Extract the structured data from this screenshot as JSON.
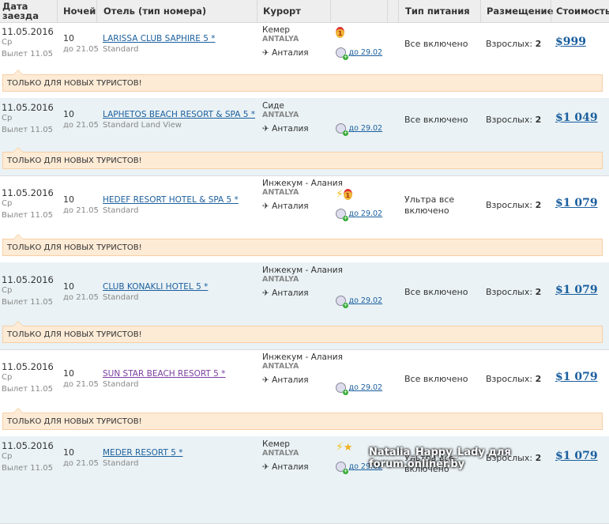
{
  "headers": [
    "Дата заезда",
    "Ночей",
    "Отель (тип номера)",
    "Курорт",
    "",
    "",
    "Тип питания",
    "Размещение",
    "Стоимость"
  ],
  "notice": "ТОЛЬКО ДЛЯ НОВЫХ ТУРИСТОВ!",
  "rows": [
    {
      "date": "11.05.2016",
      "dow": "Ср",
      "departure": "Вылет 11.05",
      "nights": "10",
      "until": "до 21.05",
      "hotel": "LARISSA CLUB SAPHIRE 5 *",
      "room": "Standard",
      "resort": "Кемер",
      "region": "ANTALYA",
      "airport": "Анталия",
      "deadline": "до 29.02",
      "meal": "Все включено",
      "acc_label": "Взрослых:",
      "acc_value": "2",
      "price": "$999",
      "icons": [
        "medal-icon"
      ]
    },
    {
      "date": "11.05.2016",
      "dow": "Ср",
      "departure": "Вылет 11.05",
      "nights": "10",
      "until": "до 21.05",
      "hotel": "LAPHETOS BEACH RESORT & SPA 5 *",
      "room": "Standard Land View",
      "resort": "Сиде",
      "region": "ANTALYA",
      "airport": "Анталия",
      "deadline": "до 29.02",
      "meal": "Все включено",
      "acc_label": "Взрослых:",
      "acc_value": "2",
      "price": "$1 049",
      "icons": []
    },
    {
      "date": "11.05.2016",
      "dow": "Ср",
      "departure": "Вылет 11.05",
      "nights": "10",
      "until": "до 21.05",
      "hotel": "HEDEF RESORT HOTEL & SPA 5 *",
      "room": "Standard",
      "resort": "Инжекум - Алания",
      "region": "ANTALYA",
      "airport": "Анталия",
      "deadline": "до 29.02",
      "meal": "Ультра все включено",
      "acc_label": "Взрослых:",
      "acc_value": "2",
      "price": "$1 079",
      "icons": [
        "bolt-icon",
        "medal-icon"
      ]
    },
    {
      "date": "11.05.2016",
      "dow": "Ср",
      "departure": "Вылет 11.05",
      "nights": "10",
      "until": "до 21.05",
      "hotel": "CLUB KONAKLI HOTEL 5 *",
      "room": "Standard",
      "resort": "Инжекум - Алания",
      "region": "ANTALYA",
      "airport": "Анталия",
      "deadline": "до 29.02",
      "meal": "Все включено",
      "acc_label": "Взрослых:",
      "acc_value": "2",
      "price": "$1 079",
      "icons": []
    },
    {
      "date": "11.05.2016",
      "dow": "Ср",
      "departure": "Вылет 11.05",
      "nights": "10",
      "until": "до 21.05",
      "hotel": "SUN STAR BEACH RESORT 5 *",
      "room": "Standard",
      "resort": "Инжекум - Алания",
      "region": "ANTALYA",
      "airport": "Анталия",
      "deadline": "до 29.02",
      "meal": "Все включено",
      "acc_label": "Взрослых:",
      "acc_value": "2",
      "price": "$1 079",
      "icons": []
    },
    {
      "date": "11.05.2016",
      "dow": "Ср",
      "departure": "Вылет 11.05",
      "nights": "10",
      "until": "до 21.05",
      "hotel": "MEDER RESORT 5 *",
      "room": "Standard",
      "resort": "Кемер",
      "region": "ANTALYA",
      "airport": "Анталия",
      "deadline": "до 29.02",
      "meal": "Ультра все включено",
      "acc_label": "Взрослых:",
      "acc_value": "2",
      "price": "$1 079",
      "icons": [
        "bolt-icon",
        "star-icon"
      ]
    }
  ],
  "watermark": "Natalia_Happy_Lady для forum.onliner.by"
}
